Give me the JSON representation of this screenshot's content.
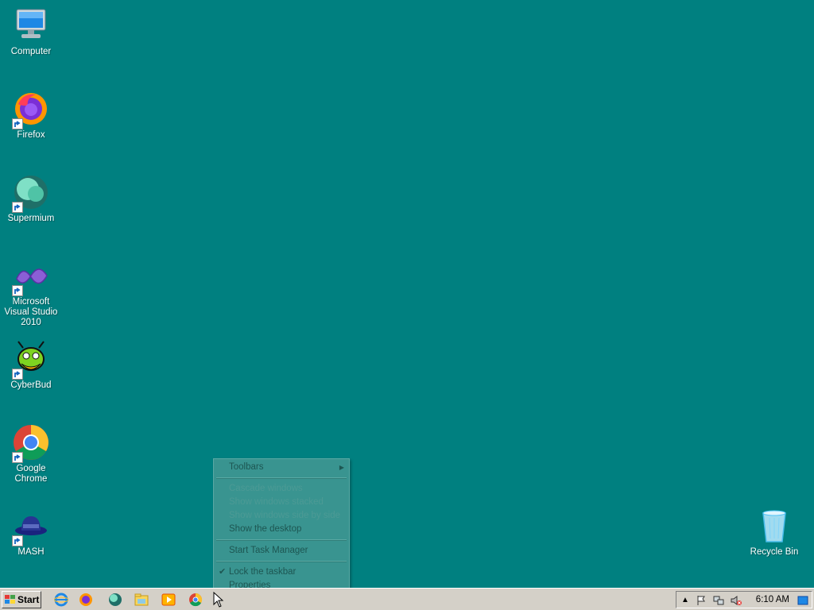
{
  "desktop": {
    "icons": [
      {
        "label": "Computer",
        "icon": "computer-icon"
      },
      {
        "label": "Firefox",
        "icon": "firefox-icon"
      },
      {
        "label": "Supermium",
        "icon": "supermium-icon"
      },
      {
        "label": "Microsoft Visual Studio 2010",
        "icon": "visual-studio-icon"
      },
      {
        "label": "CyberBud",
        "icon": "cyberbud-icon"
      },
      {
        "label": "Google Chrome",
        "icon": "chrome-icon"
      },
      {
        "label": "MASH",
        "icon": "mash-icon"
      },
      {
        "label": "Recycle Bin",
        "icon": "recycle-bin-icon"
      }
    ],
    "background_color": "#008080"
  },
  "context_menu": {
    "items": [
      {
        "label": "Toolbars",
        "submenu": true,
        "enabled": true
      },
      {
        "label": "Cascade windows",
        "enabled": false
      },
      {
        "label": "Show windows stacked",
        "enabled": false
      },
      {
        "label": "Show windows side by side",
        "enabled": false
      },
      {
        "label": "Show the desktop",
        "enabled": true
      },
      {
        "label": "Start Task Manager",
        "enabled": true
      },
      {
        "label": "Lock the taskbar",
        "checked": true,
        "enabled": true
      },
      {
        "label": "Properties",
        "enabled": true
      }
    ]
  },
  "taskbar": {
    "start_label": "Start",
    "quick_launch": [
      "internet-explorer-icon",
      "firefox-icon",
      "supermium-icon",
      "file-explorer-icon",
      "media-player-icon",
      "chrome-icon"
    ],
    "tray": {
      "icons": [
        "show-hidden-icons-icon",
        "action-center-flag-icon",
        "network-icon",
        "volume-muted-icon"
      ],
      "clock": "6:10 AM"
    }
  }
}
